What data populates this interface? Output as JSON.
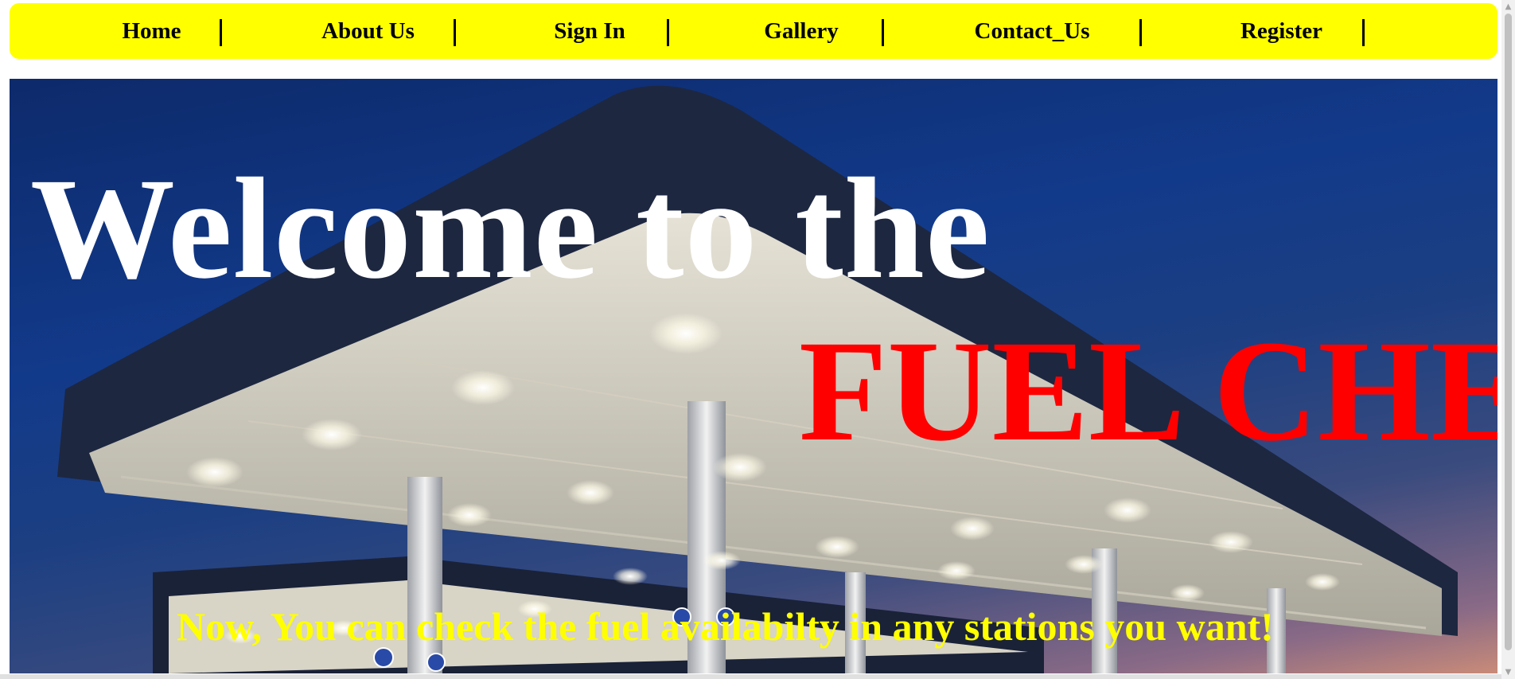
{
  "nav": {
    "items": [
      {
        "label": "Home"
      },
      {
        "label": "About Us"
      },
      {
        "label": "Sign In"
      },
      {
        "label": "Gallery"
      },
      {
        "label": "Contact_Us"
      },
      {
        "label": "Register"
      }
    ]
  },
  "hero": {
    "welcome": "Welcome to the",
    "brand": "FUEL CHE",
    "tagline": "Now, You can check the fuel availabilty in any stations you want!"
  },
  "colors": {
    "nav_background": "#ffff00",
    "brand_text": "#ff0000",
    "tagline_text": "#ffff00",
    "welcome_text": "#ffffff"
  }
}
